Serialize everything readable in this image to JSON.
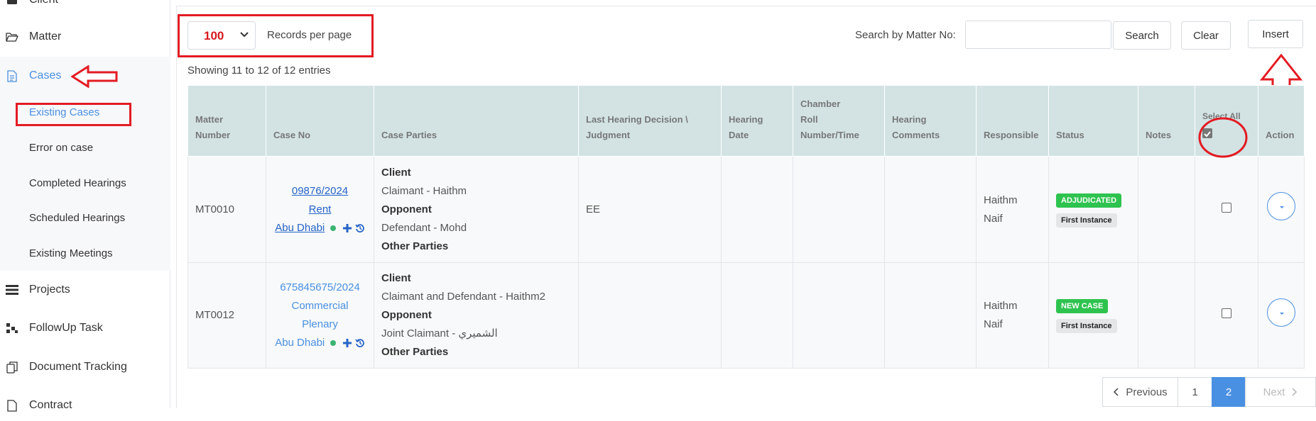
{
  "sidebar": {
    "items": [
      {
        "label": "Client",
        "icon": "briefcase-icon"
      },
      {
        "label": "Matter",
        "icon": "folder-open-icon"
      },
      {
        "label": "Cases",
        "icon": "document-icon"
      },
      {
        "label": "Projects",
        "icon": "list-icon"
      },
      {
        "label": "FollowUp Task",
        "icon": "tasks-icon"
      },
      {
        "label": "Document Tracking",
        "icon": "copy-icon"
      },
      {
        "label": "Contract",
        "icon": "file-icon"
      }
    ],
    "cases_subitems": [
      {
        "label": "Existing Cases"
      },
      {
        "label": "Error on case"
      },
      {
        "label": "Completed Hearings"
      },
      {
        "label": "Scheduled Hearings"
      },
      {
        "label": "Existing Meetings"
      }
    ]
  },
  "toolbar": {
    "page_size": "100",
    "records_per_page": "Records per page",
    "search_label": "Search by Matter No:",
    "search_value": "",
    "search_button": "Search",
    "clear_button": "Clear",
    "insert_button": "Insert"
  },
  "showing": "Showing 11 to 12 of 12 entries",
  "table": {
    "headers": {
      "matter_number": [
        "Matter",
        "Number"
      ],
      "case_no": "Case No",
      "case_parties": "Case Parties",
      "last_hearing": [
        "Last Hearing Decision \\",
        "Judgment"
      ],
      "hearing_date": "Hearing Date",
      "chamber": [
        "Chamber",
        "Roll",
        "Number/Time"
      ],
      "hearing_comments": [
        "Hearing",
        "Comments"
      ],
      "responsible": "Responsible",
      "status": "Status",
      "notes": "Notes",
      "select_all": "Select All",
      "action": "Action"
    },
    "rows": [
      {
        "matter": "MT0010",
        "case_no": "09876/2024",
        "case_type": "Rent",
        "case_city": "Abu Dhabi",
        "client_h": "Client",
        "client": "Claimant - Haithm",
        "opponent_h": "Opponent",
        "opponent": "Defendant - Mohd",
        "other_h": "Other Parties",
        "last_hearing": "EE",
        "hearing_date": "",
        "chamber": "",
        "hearing_comments": "",
        "responsible": [
          "Haithm",
          "Naif"
        ],
        "status_badge": "ADJUDICATED",
        "instance_badge": "First Instance",
        "notes": ""
      },
      {
        "matter": "MT0012",
        "case_no": "675845675/2024",
        "case_type": "Commercial",
        "case_type2": "Plenary",
        "case_city": "Abu Dhabi",
        "client_h": "Client",
        "client": "Claimant and Defendant - Haithm2",
        "opponent_h": "Opponent",
        "opponent": "Joint Claimant - الشميري",
        "other_h": "Other Parties",
        "last_hearing": "",
        "hearing_date": "",
        "chamber": "",
        "hearing_comments": "",
        "responsible": [
          "Haithm",
          "Naif"
        ],
        "status_badge": "NEW CASE",
        "instance_badge": "First Instance",
        "notes": ""
      }
    ]
  },
  "pagination": {
    "previous": "Previous",
    "pages": [
      "1",
      "2"
    ],
    "current": "2",
    "next": "Next"
  },
  "colors": {
    "accent": "#4a90e2",
    "annotation_red": "#e31b23",
    "header_bg": "#d3e3e4",
    "badge_green": "#2ec34f"
  }
}
